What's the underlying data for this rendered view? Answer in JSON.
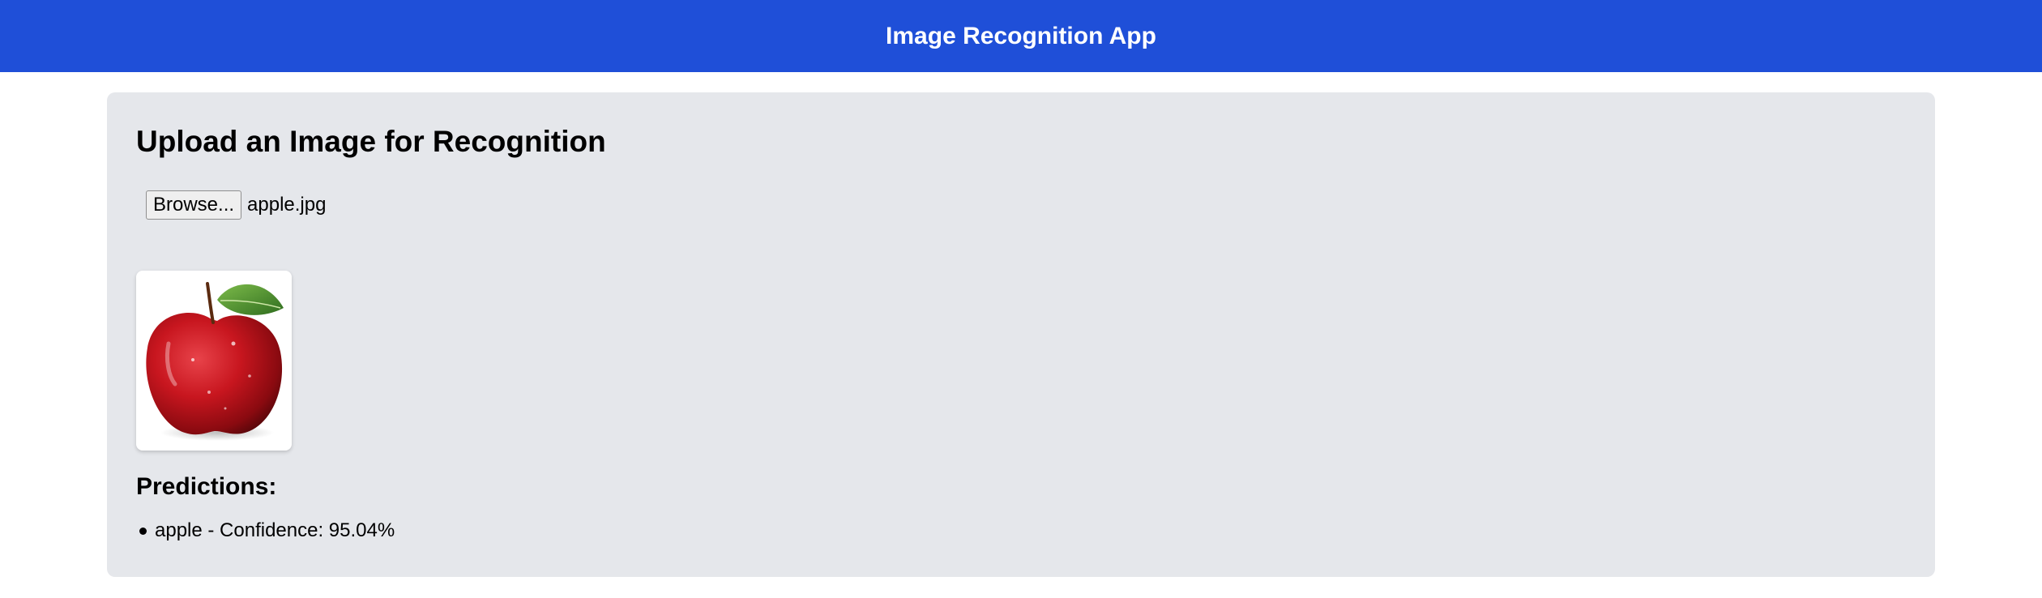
{
  "header": {
    "title": "Image Recognition App"
  },
  "upload": {
    "heading": "Upload an Image for Recognition",
    "browse_label": "Browse...",
    "file_name": "apple.jpg"
  },
  "preview": {
    "icon": "apple-photo"
  },
  "predictions": {
    "heading": "Predictions:",
    "items": [
      {
        "text": "apple - Confidence: 95.04%"
      }
    ]
  },
  "colors": {
    "header_bg": "#1f4fd8",
    "card_bg": "#e5e7eb",
    "page_bg": "#ffffff"
  }
}
